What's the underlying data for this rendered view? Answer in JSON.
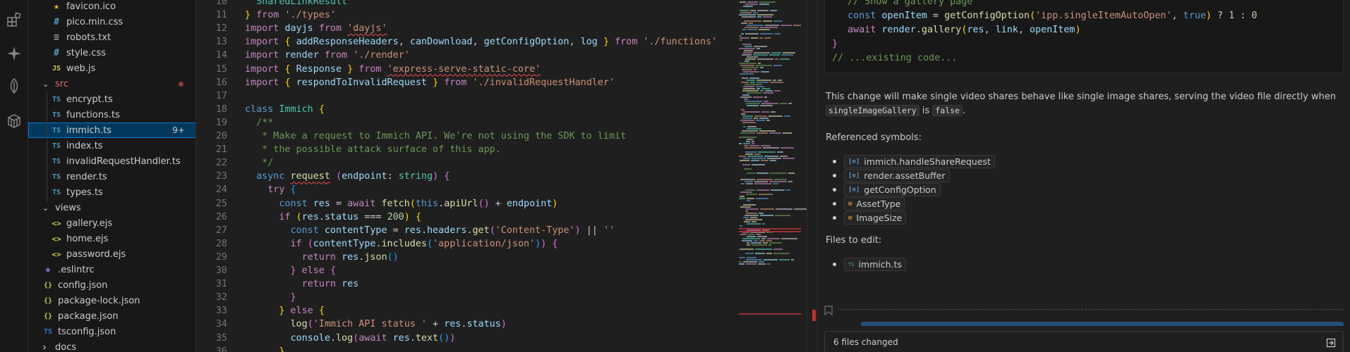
{
  "explorer": {
    "items": [
      {
        "name": "favicon.ico",
        "icon": "star-icon",
        "kind": "star"
      },
      {
        "name": "pico.min.css",
        "icon": "hash-icon",
        "kind": "css"
      },
      {
        "name": "robots.txt",
        "icon": "lines-icon",
        "kind": "txt"
      },
      {
        "name": "style.css",
        "icon": "hash-icon",
        "kind": "css"
      },
      {
        "name": "web.js",
        "icon": "js-icon",
        "kind": "js"
      },
      {
        "name": "src",
        "icon": "chevron-down-icon",
        "kind": "folder"
      },
      {
        "name": "encrypt.ts",
        "icon": "ts-icon",
        "kind": "ts"
      },
      {
        "name": "functions.ts",
        "icon": "ts-icon",
        "kind": "ts"
      },
      {
        "name": "immich.ts",
        "icon": "ts-icon",
        "kind": "ts",
        "badge": "9+"
      },
      {
        "name": "index.ts",
        "icon": "ts-icon",
        "kind": "ts"
      },
      {
        "name": "invalidRequestHandler.ts",
        "icon": "ts-icon",
        "kind": "ts"
      },
      {
        "name": "render.ts",
        "icon": "ts-icon",
        "kind": "ts"
      },
      {
        "name": "types.ts",
        "icon": "ts-icon",
        "kind": "ts"
      },
      {
        "name": "views",
        "icon": "chevron-down-icon",
        "kind": "folder"
      },
      {
        "name": "gallery.ejs",
        "icon": "ejs-icon",
        "kind": "ejs"
      },
      {
        "name": "home.ejs",
        "icon": "ejs-icon",
        "kind": "ejs"
      },
      {
        "name": "password.ejs",
        "icon": "ejs-icon",
        "kind": "ejs"
      },
      {
        "name": ".eslintrc",
        "icon": "eslint-icon",
        "kind": "eslint"
      },
      {
        "name": "config.json",
        "icon": "json-icon",
        "kind": "json"
      },
      {
        "name": "package-lock.json",
        "icon": "json-icon",
        "kind": "json"
      },
      {
        "name": "package.json",
        "icon": "json-icon",
        "kind": "json"
      },
      {
        "name": "tsconfig.json",
        "icon": "tsconfig-icon",
        "kind": "tsconfig"
      },
      {
        "name": "docs",
        "icon": "chevron-right-icon",
        "kind": "folder"
      }
    ]
  },
  "editor": {
    "line_numbers": [
      "10",
      "11",
      "12",
      "13",
      "14",
      "15",
      "16",
      "17",
      "18",
      "19",
      "20",
      "21",
      "22",
      "23",
      "24",
      "25",
      "26",
      "27",
      "28",
      "29",
      "30",
      "31",
      "32",
      "33",
      "34",
      "35",
      "36"
    ]
  },
  "chat": {
    "code_lines": [
      "// Show a gallery page",
      "const openItem = getConfigOption('ipp.singleItemAutoOpen', true) ? 1 : 0",
      "await render.gallery(res, link, openItem)",
      "}",
      "// ...existing code..."
    ],
    "explanation_before": "This change will make single video shares behave like single image shares, serving the video file directly when",
    "explanation_code1": "singleImageGallery",
    "explanation_is": "is",
    "explanation_code2": "false",
    "explanation_end": ".",
    "referenced_heading": "Referenced symbols:",
    "referenced": [
      {
        "label": "immich.handleShareRequest",
        "icon": "symbol-method-icon"
      },
      {
        "label": "render.assetBuffer",
        "icon": "symbol-method-icon"
      },
      {
        "label": "getConfigOption",
        "icon": "symbol-method-icon"
      },
      {
        "label": "AssetType",
        "icon": "symbol-class-icon"
      },
      {
        "label": "ImageSize",
        "icon": "symbol-class-icon"
      }
    ],
    "files_heading": "Files to edit:",
    "files": [
      {
        "label": "immich.ts",
        "icon": "ts-icon"
      }
    ],
    "files_changed": "6 files changed"
  }
}
